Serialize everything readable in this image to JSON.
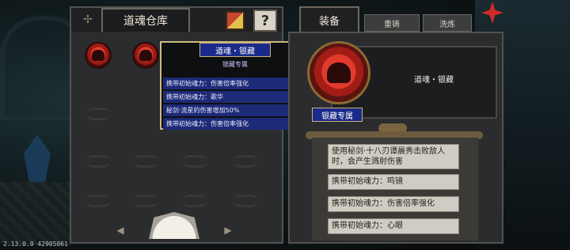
{
  "version": "2.13.0.0 42905061",
  "left_panel": {
    "title": "道魂仓库",
    "help_label": "?"
  },
  "tooltip": {
    "title": "道魂・银藏",
    "subtitle": "银藏专属",
    "rows": [
      "携带初始魂力：伤害倍率强化",
      "携带初始魂力：歌华",
      "秘剑·流星的伤害增加50%",
      "携带初始魂力：伤害倍率强化"
    ]
  },
  "right_panel": {
    "tabs": [
      "装备",
      "重铸",
      "洗炼"
    ],
    "equipped_name": "道魂・银藏",
    "exclusive_label": "银藏专属",
    "effects": [
      "使用秘剑·十八刃谭晨秀击败敌人时，会产生溅射伤害",
      "携带初始魂力：鸣镜",
      "携带初始魂力：伤害倍率强化",
      "携带初始魂力：心眼"
    ]
  },
  "colors": {
    "panel": "#2b2c2d",
    "tooltip_blue": "#1b2a8a",
    "gold_border": "#cdb880",
    "orb_red": "#e24030"
  }
}
